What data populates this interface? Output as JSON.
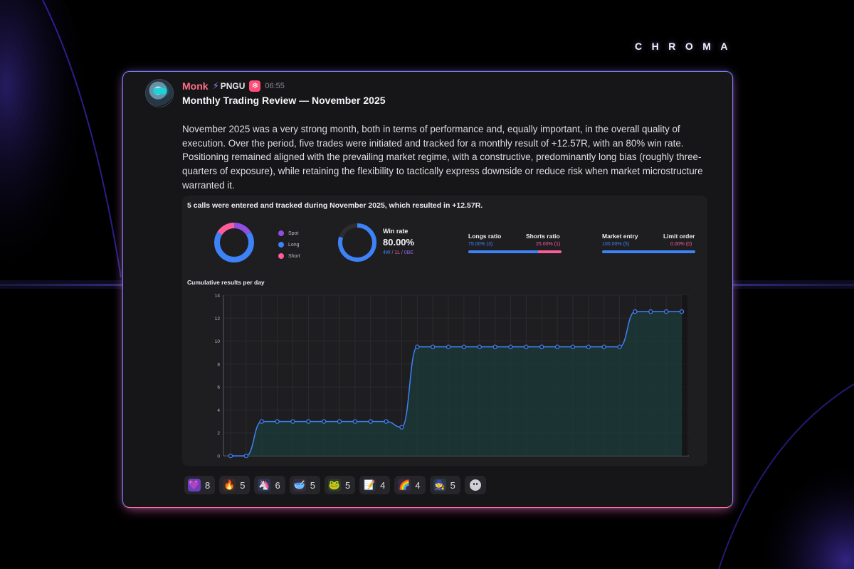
{
  "brand": "CHROMA",
  "message": {
    "author": "Monk",
    "tag": "PNGU",
    "role_icon": "snowflake-icon",
    "time": "06:55",
    "title": "Monthly Trading Review — November 2025",
    "body": "November 2025 was a very strong month, both in terms of performance and, equally important, in the overall quality of execution. Over the period, five trades were initiated and tracked for a monthly result of +12.57R, with an 80% win rate. Positioning remained aligned with the prevailing market regime, with a constructive, predominantly long bias (roughly three-quarters of exposure), while retaining the flexibility to tactically express downside or reduce risk when market microstructure warranted it."
  },
  "panel": {
    "headline": "5 calls were entered and tracked during November 2025, which resulted in +12.57R.",
    "distribution": {
      "legend": [
        {
          "label": "Spot",
          "color": "#8f4fe0",
          "value": 0.16
        },
        {
          "label": "Long",
          "color": "#3e82f7",
          "value": 0.68
        },
        {
          "label": "Short",
          "color": "#ff5b9b",
          "value": 0.16
        }
      ]
    },
    "winrate": {
      "label": "Win rate",
      "value": "80.00%",
      "fraction": 0.8,
      "w": "4W",
      "l": "1L",
      "be": "0BE",
      "sep": "/"
    },
    "ratios": {
      "longs_label": "Longs ratio",
      "shorts_label": "Shorts ratio",
      "longs_value": "75.00% (3)",
      "shorts_value": "25.00% (1)",
      "longs_fraction": 0.75,
      "market_label": "Market entry",
      "limit_label": "Limit order",
      "market_value": "100.00% (5)",
      "limit_value": "0.00% (0)",
      "market_fraction": 1.0
    },
    "chart_title": "Cumulative results per day"
  },
  "chart_data": {
    "type": "line",
    "title": "Cumulative results per day",
    "x": [
      1,
      2,
      3,
      4,
      5,
      6,
      7,
      8,
      9,
      10,
      11,
      12,
      13,
      14,
      15,
      16,
      17,
      18,
      19,
      20,
      21,
      22,
      23,
      24,
      25,
      26,
      27,
      28,
      29,
      30
    ],
    "values": [
      0,
      0,
      3,
      3,
      3,
      3,
      3,
      3,
      3,
      3,
      3,
      2.5,
      9.5,
      9.5,
      9.5,
      9.5,
      9.5,
      9.5,
      9.5,
      9.5,
      9.5,
      9.5,
      9.5,
      9.5,
      9.5,
      9.5,
      12.57,
      12.57,
      12.57,
      12.57
    ],
    "y_ticks": [
      "0",
      "2",
      "4",
      "6",
      "8",
      "10",
      "12",
      "14"
    ],
    "ylim": [
      0,
      14
    ],
    "grid": true,
    "line_color": "#3e82f7",
    "fill_color": "#1c3b3a"
  },
  "reactions": [
    {
      "icon": "purple-heart-icon",
      "glyph": "💜",
      "count": "8",
      "bg": "#6b3fc4"
    },
    {
      "icon": "fire-icon",
      "glyph": "🔥",
      "count": "5",
      "bg": "#3a2a2a"
    },
    {
      "icon": "unicorn-icon",
      "glyph": "🦄",
      "count": "6",
      "bg": "#2c3456"
    },
    {
      "icon": "bowl-icon",
      "glyph": "🥣",
      "count": "5",
      "bg": "#3a2b3c"
    },
    {
      "icon": "pepe-icon",
      "glyph": "🐸",
      "count": "5",
      "bg": "#2d3a2a"
    },
    {
      "icon": "memo-icon",
      "glyph": "📝",
      "count": "4",
      "bg": "#2f2f36"
    },
    {
      "icon": "rainbow-cat-icon",
      "glyph": "🌈",
      "count": "4",
      "bg": "#3a2946"
    },
    {
      "icon": "pepe-wizard-icon",
      "glyph": "🧙",
      "count": "5",
      "bg": "#2b3a48"
    }
  ]
}
